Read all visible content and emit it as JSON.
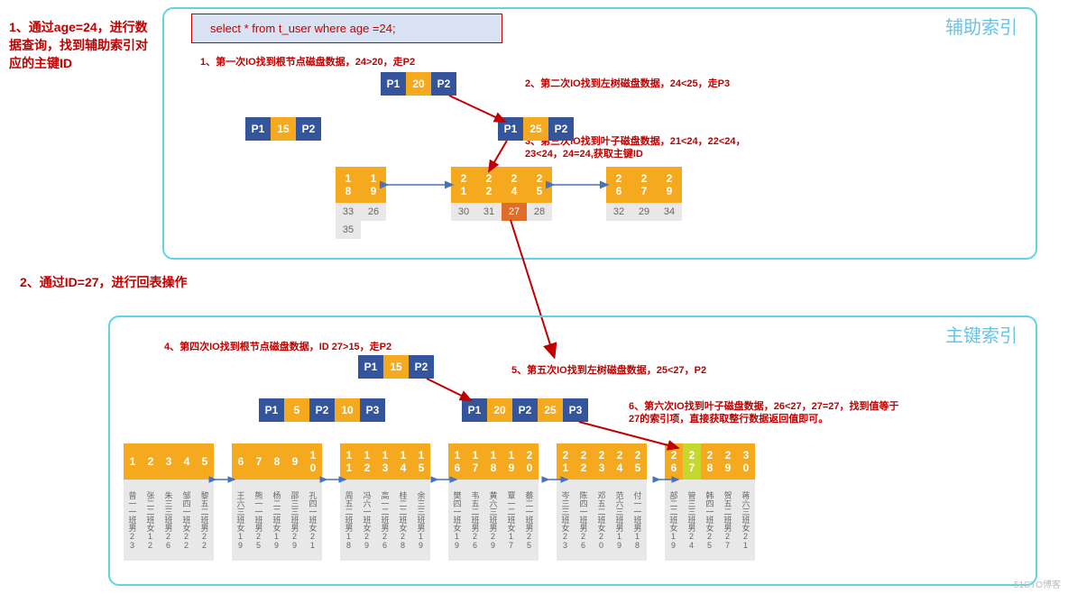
{
  "step1": "1、通过age=24，进行数据查询，找到辅助索引对应的主键ID",
  "step2": "2、通过ID=27，进行回表操作",
  "panel1_title": "辅助索引",
  "panel2_title": "主键索引",
  "sql": "select * from t_user where age =24;",
  "n1": "1、第一次IO找到根节点磁盘数据，24>20，走P2",
  "n2": "2、第二次IO找到左树磁盘数据，24<25，走P3",
  "n3": "3、第三次IO找到叶子磁盘数据，21<24，22<24，23<24，24=24,获取主键ID",
  "n4": "4、第四次IO找到根节点磁盘数据，ID 27>15，走P2",
  "n5": "5、第五次IO找到左树磁盘数据，25<27，P2",
  "n6": "6、第六次IO找到叶子磁盘数据，26<27，27=27，找到值等于27的索引项，直接获取整行数据返回值即可。",
  "labels": {
    "p1": "P1",
    "p2": "P2",
    "p3": "P3"
  },
  "aux_tree": {
    "root": {
      "key": "20"
    },
    "l1_left": {
      "key": "15"
    },
    "l1_right": {
      "key": "25"
    },
    "leaf_left": {
      "keys": [
        [
          "1",
          "8"
        ],
        [
          "1",
          "9"
        ]
      ],
      "data": [
        [
          "33",
          "35"
        ],
        [
          "26"
        ]
      ]
    },
    "leaf_mid": {
      "keys": [
        [
          "2",
          "1"
        ],
        [
          "2",
          "2"
        ],
        [
          "2",
          "4"
        ],
        [
          "2",
          "5"
        ]
      ],
      "data": [
        "30",
        "31",
        "27",
        "28"
      ],
      "hi": 2
    },
    "leaf_right": {
      "keys": [
        [
          "2",
          "6"
        ],
        [
          "2",
          "7"
        ],
        [
          "2",
          "9"
        ]
      ],
      "data": [
        "32",
        "29",
        "34"
      ]
    }
  },
  "pk_tree": {
    "root": {
      "key": "15"
    },
    "l1_left": {
      "keys": [
        "5",
        "10"
      ]
    },
    "l1_right": {
      "keys": [
        "20",
        "25"
      ]
    },
    "leaves": [
      {
        "keys": [
          [
            "1"
          ],
          [
            "2"
          ],
          [
            "3"
          ],
          [
            "4"
          ],
          [
            "5"
          ]
        ],
        "data": [
          "曾一一班男23",
          "张二二班女12",
          "朱三三班男26",
          "邹四一班女22",
          "黎五二班男22"
        ]
      },
      {
        "keys": [
          [
            "6"
          ],
          [
            "7"
          ],
          [
            "8"
          ],
          [
            "9"
          ],
          [
            "1",
            "0"
          ]
        ],
        "data": [
          "王六三班女19",
          "熊一一班男25",
          "杨二二班女19",
          "邵三三班男29",
          "孔四一班女21"
        ]
      },
      {
        "keys": [
          [
            "1",
            "1"
          ],
          [
            "1",
            "2"
          ],
          [
            "1",
            "3"
          ],
          [
            "1",
            "4"
          ],
          [
            "1",
            "5"
          ]
        ],
        "data": [
          "周五二班男18",
          "冯六一班女29",
          "高一二班男26",
          "桂二二班女28",
          "余三三班男19"
        ]
      },
      {
        "keys": [
          [
            "1",
            "6"
          ],
          [
            "1",
            "7"
          ],
          [
            "1",
            "8"
          ],
          [
            "1",
            "9"
          ],
          [
            "2",
            "0"
          ]
        ],
        "data": [
          "樊四一班女19",
          "韦五二班男26",
          "黄六三班男29",
          "覃一二班女17",
          "蔡二一班男25"
        ]
      },
      {
        "keys": [
          [
            "2",
            "1"
          ],
          [
            "2",
            "2"
          ],
          [
            "2",
            "3"
          ],
          [
            "2",
            "4"
          ],
          [
            "2",
            "5"
          ]
        ],
        "data": [
          "岑三三班女23",
          "陈四一班男26",
          "邓五二班女20",
          "范六三班男19",
          "付一一班男18"
        ]
      },
      {
        "keys": [
          [
            "2",
            "6"
          ],
          [
            "2",
            "7"
          ],
          [
            "2",
            "8"
          ],
          [
            "2",
            "9"
          ],
          [
            "3",
            "0"
          ]
        ],
        "data": [
          "部二二班女19",
          "管三三班男24",
          "韩四一班女25",
          "贺五二班男27",
          "蒋六三班女21"
        ],
        "hi": 1
      }
    ]
  },
  "watermark": "51CTO博客"
}
